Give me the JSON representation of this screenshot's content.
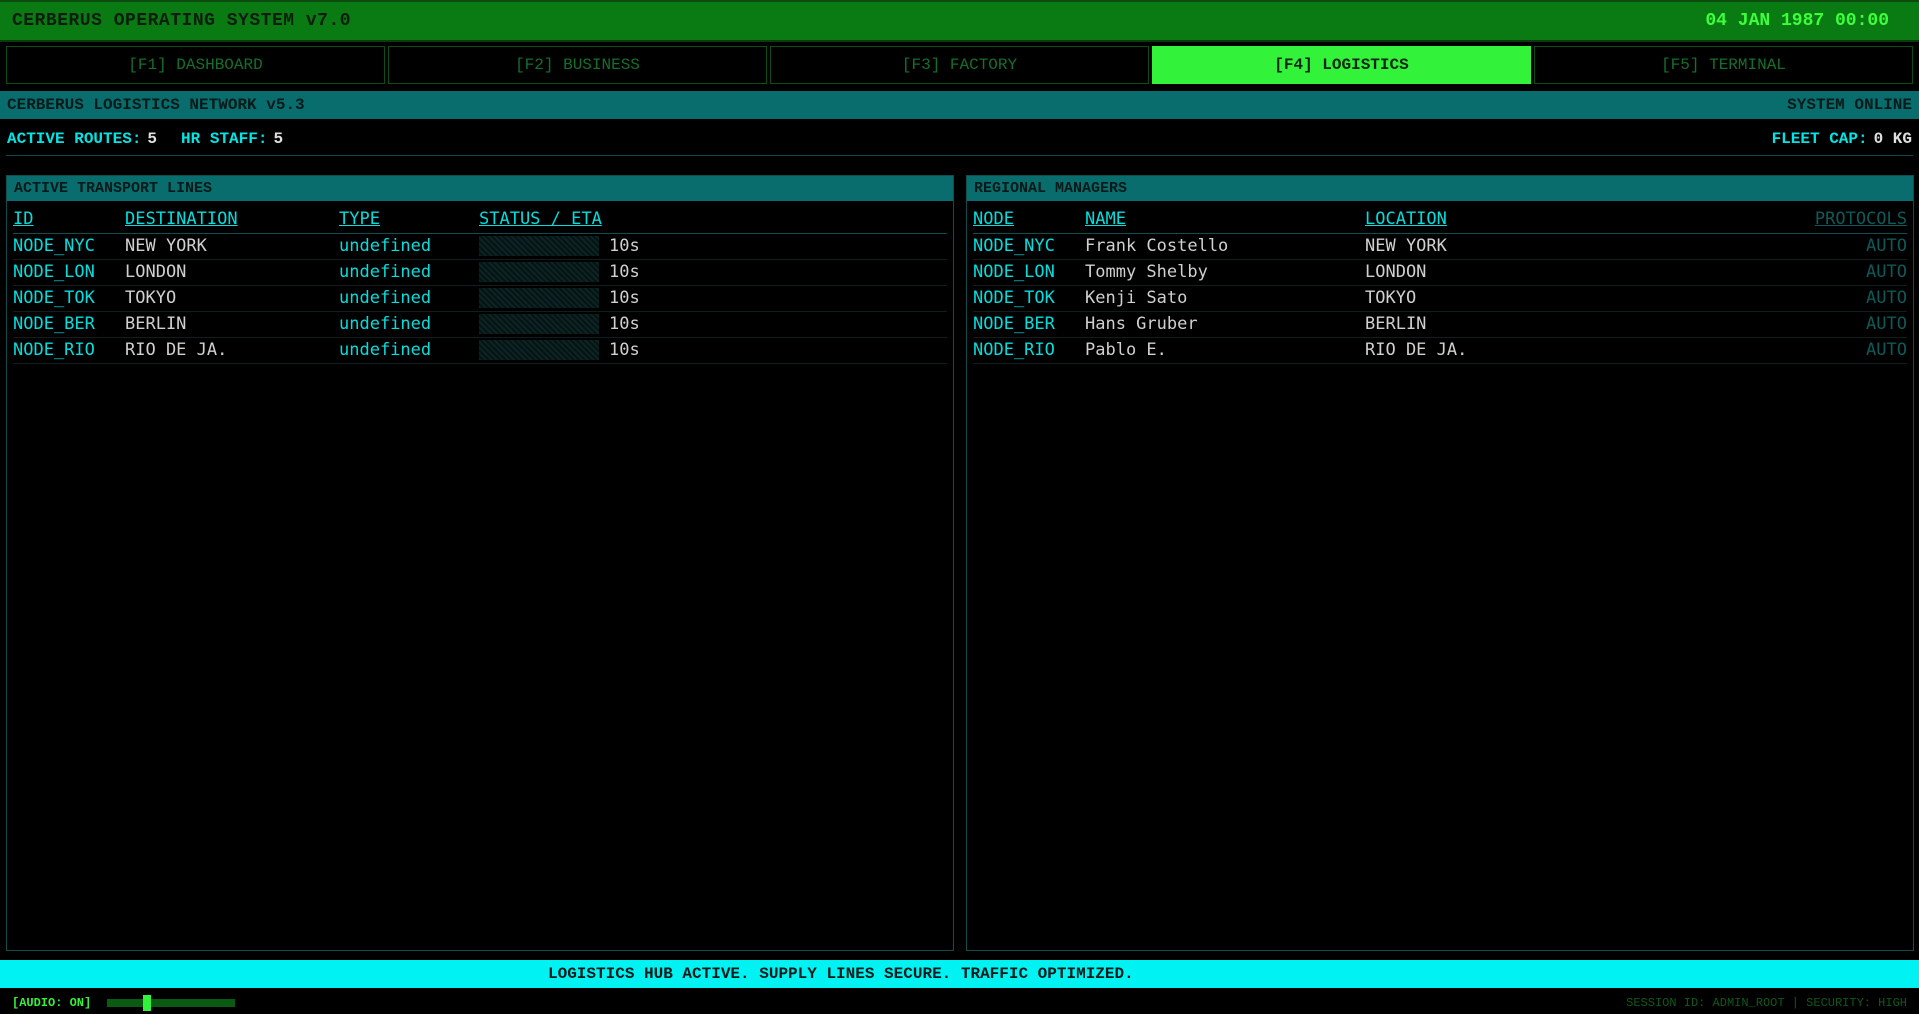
{
  "app": {
    "title": "CERBERUS OPERATING SYSTEM v7.0",
    "clock": "04 JAN 1987 00:00"
  },
  "tabs": [
    {
      "label": "[F1] DASHBOARD"
    },
    {
      "label": "[F2] BUSINESS"
    },
    {
      "label": "[F3] FACTORY"
    },
    {
      "label": "[F4] LOGISTICS",
      "active": true
    },
    {
      "label": "[F5] TERMINAL"
    }
  ],
  "network": {
    "title": "CERBERUS LOGISTICS NETWORK v5.3",
    "status": "SYSTEM ONLINE"
  },
  "stats": {
    "routes_label": "ACTIVE ROUTES:",
    "routes_value": "5",
    "staff_label": "HR STAFF:",
    "staff_value": "5",
    "fleet_label": "FLEET CAP:",
    "fleet_value": "0 KG"
  },
  "transport": {
    "title": "ACTIVE TRANSPORT LINES",
    "headers": [
      "ID",
      "DESTINATION",
      "TYPE",
      "STATUS / ETA"
    ],
    "rows": [
      {
        "id": "NODE_NYC",
        "dest": "NEW YORK",
        "type": "undefined",
        "eta": "10s"
      },
      {
        "id": "NODE_LON",
        "dest": "LONDON",
        "type": "undefined",
        "eta": "10s"
      },
      {
        "id": "NODE_TOK",
        "dest": "TOKYO",
        "type": "undefined",
        "eta": "10s"
      },
      {
        "id": "NODE_BER",
        "dest": "BERLIN",
        "type": "undefined",
        "eta": "10s"
      },
      {
        "id": "NODE_RIO",
        "dest": "RIO DE JA.",
        "type": "undefined",
        "eta": "10s"
      }
    ]
  },
  "managers": {
    "title": "REGIONAL MANAGERS",
    "headers": [
      "NODE",
      "NAME",
      "LOCATION",
      "PROTOCOLS"
    ],
    "rows": [
      {
        "node": "NODE_NYC",
        "name": "Frank Costello",
        "loc": "NEW YORK",
        "proto": "AUTO"
      },
      {
        "node": "NODE_LON",
        "name": "Tommy Shelby",
        "loc": "LONDON",
        "proto": "AUTO"
      },
      {
        "node": "NODE_TOK",
        "name": "Kenji Sato",
        "loc": "TOKYO",
        "proto": "AUTO"
      },
      {
        "node": "NODE_BER",
        "name": "Hans Gruber",
        "loc": "BERLIN",
        "proto": "AUTO"
      },
      {
        "node": "NODE_RIO",
        "name": "Pablo E.",
        "loc": "RIO DE JA.",
        "proto": "AUTO"
      }
    ]
  },
  "ticker": "LOGISTICS HUB ACTIVE. SUPPLY LINES SECURE. TRAFFIC OPTIMIZED.",
  "bottom": {
    "audio": "[AUDIO: ON]",
    "volume": 0.3,
    "session": "SESSION ID: ADMIN_ROOT | SECURITY: HIGH"
  }
}
